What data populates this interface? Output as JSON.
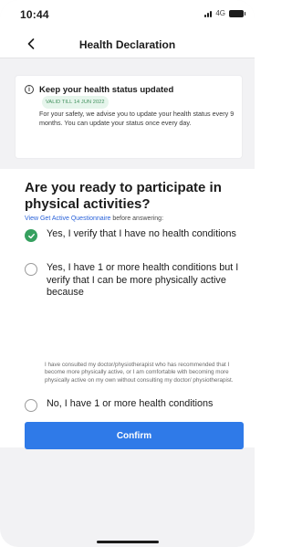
{
  "status_bar": {
    "time": "10:44",
    "network": "4G"
  },
  "nav": {
    "title": "Health Declaration",
    "back_icon": "chevron-left-icon"
  },
  "info_card": {
    "icon": "info-icon",
    "icon_glyph": "i",
    "title": "Keep your health status updated",
    "badge": "VALID TILL 14 JUN 2022",
    "body": "For your safety, we advise you to update your health status every 9 months. You can update your status once every day."
  },
  "question": {
    "title": "Are you ready to participate in physical activities?",
    "link_text": "View Get Active Questionnaire",
    "link_suffix": " before answering:"
  },
  "options": [
    {
      "label": "Yes, I verify that I have no health conditions",
      "selected": true
    },
    {
      "label": "Yes, I have 1 or more health conditions but I verify that I can be more physically active because",
      "selected": false
    },
    {
      "label": "No, I have 1 or more health conditions",
      "selected": false
    }
  ],
  "option_sub_text": "I have consulted my doctor/physiotherapist who has recommended that I become more physically active, or I am comfortable with becoming more physically active on my own without consulting my doctor/ physiotherapist.",
  "confirm_label": "Confirm",
  "colors": {
    "accent": "#2f7ae8",
    "selected": "#36a05f",
    "badge_bg": "#e6f5ec",
    "badge_text": "#3f8f5c",
    "link": "#2962d9"
  }
}
